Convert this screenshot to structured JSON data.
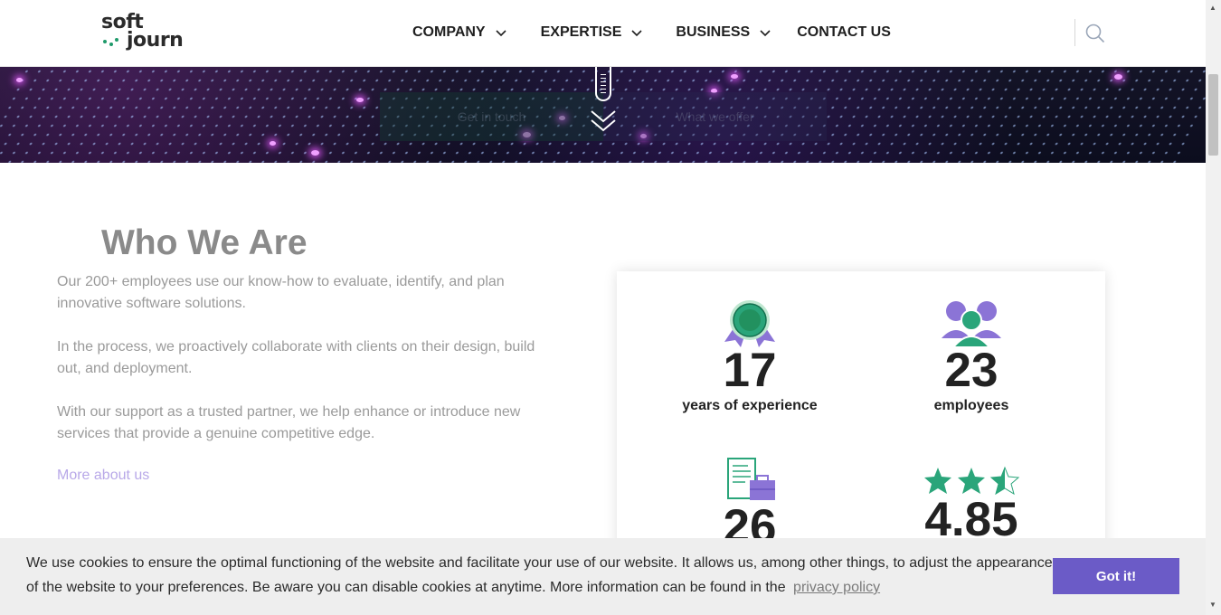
{
  "header": {
    "logo_line1": "soft",
    "logo_line2": "journ",
    "nav": [
      {
        "label": "COMPANY"
      },
      {
        "label": "EXPERTISE"
      },
      {
        "label": "BUSINESS"
      },
      {
        "label": "CONTACT US"
      }
    ]
  },
  "hero": {
    "faded_left": "Get in touch",
    "faded_right": "What we offer"
  },
  "about": {
    "title": "Who We Are",
    "p1": "Our 200+ employees use our know-how to evaluate, identify, and plan innovative software solutions.",
    "p2": "In the process, we proactively collaborate with clients on their design, build out, and deployment.",
    "p3": "With our support as a trusted partner, we help enhance or introduce new services that provide a genuine competitive edge.",
    "link": "More about us"
  },
  "stats": [
    {
      "number": "17",
      "label": "years of experience",
      "icon": "award-ribbon-icon"
    },
    {
      "number": "23",
      "label": "employees",
      "icon": "team-people-icon"
    },
    {
      "number": "26",
      "label": "",
      "icon": "document-briefcase-icon"
    },
    {
      "number": "4.85",
      "label": "",
      "icon": "rating-stars-icon"
    }
  ],
  "cookie": {
    "text": "We use cookies to ensure the optimal functioning of the website and facilitate your use of our website. It allows us, among other things, to adjust the appearance of the website to your preferences. Be aware you can disable cookies at anytime. More information can be found in the",
    "link": "privacy policy",
    "button": "Got it!"
  },
  "colors": {
    "accent_purple": "#6b5bc7",
    "brand_green": "#1e9a6a",
    "title_gray": "#8a8a8a"
  }
}
